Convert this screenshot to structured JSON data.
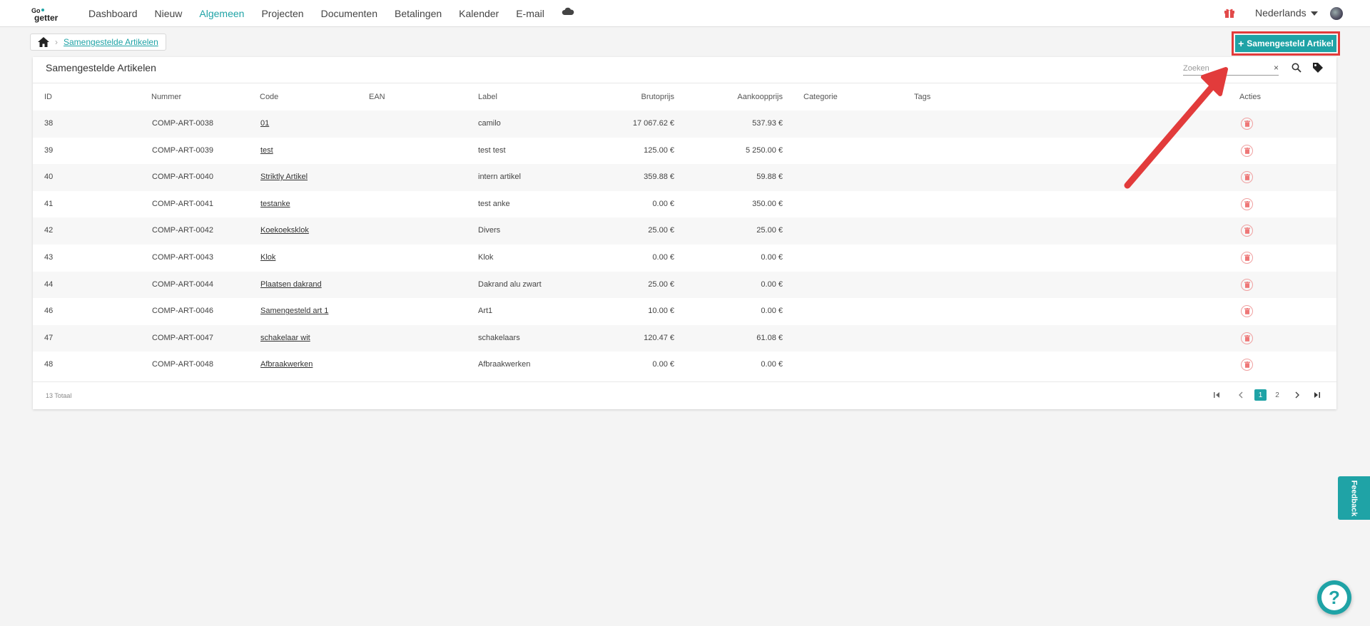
{
  "nav": {
    "logo_alt": "GoGetter",
    "items": [
      "Dashboard",
      "Nieuw",
      "Algemeen",
      "Projecten",
      "Documenten",
      "Betalingen",
      "Kalender",
      "E-mail"
    ],
    "active": "Algemeen",
    "language": "Nederlands"
  },
  "breadcrumb": {
    "current": "Samengestelde Artikelen"
  },
  "add_button_label": "Samengesteld Artikel",
  "card": {
    "title": "Samengestelde Artikelen",
    "search_placeholder": "Zoeken",
    "search_clear": "×"
  },
  "table": {
    "columns": [
      "ID",
      "Nummer",
      "Code",
      "EAN",
      "Label",
      "Brutoprijs",
      "Aankoopprijs",
      "Categorie",
      "Tags",
      "Acties"
    ],
    "rows": [
      {
        "id": "38",
        "nummer": "COMP-ART-0038",
        "code": "01",
        "ean": "",
        "label": "camilo",
        "brutoprijs": "17 067.62 €",
        "aankoopprijs": "537.93 €"
      },
      {
        "id": "39",
        "nummer": "COMP-ART-0039",
        "code": "test",
        "ean": "",
        "label": "test test",
        "brutoprijs": "125.00 €",
        "aankoopprijs": "5 250.00 €"
      },
      {
        "id": "40",
        "nummer": "COMP-ART-0040",
        "code": "Striktly Artikel",
        "ean": "",
        "label": "intern artikel",
        "brutoprijs": "359.88 €",
        "aankoopprijs": "59.88 €"
      },
      {
        "id": "41",
        "nummer": "COMP-ART-0041",
        "code": "testanke",
        "ean": "",
        "label": "test anke",
        "brutoprijs": "0.00 €",
        "aankoopprijs": "350.00 €"
      },
      {
        "id": "42",
        "nummer": "COMP-ART-0042",
        "code": "Koekoeksklok",
        "ean": "",
        "label": "Divers",
        "brutoprijs": "25.00 €",
        "aankoopprijs": "25.00 €"
      },
      {
        "id": "43",
        "nummer": "COMP-ART-0043",
        "code": "Klok",
        "ean": "",
        "label": "Klok",
        "brutoprijs": "0.00 €",
        "aankoopprijs": "0.00 €"
      },
      {
        "id": "44",
        "nummer": "COMP-ART-0044",
        "code": "Plaatsen dakrand",
        "ean": "",
        "label": "Dakrand alu zwart",
        "brutoprijs": "25.00 €",
        "aankoopprijs": "0.00 €"
      },
      {
        "id": "46",
        "nummer": "COMP-ART-0046",
        "code": "Samengesteld art 1",
        "ean": "",
        "label": "Art1",
        "brutoprijs": "10.00 €",
        "aankoopprijs": "0.00 €"
      },
      {
        "id": "47",
        "nummer": "COMP-ART-0047",
        "code": "schakelaar wit",
        "ean": "",
        "label": "schakelaars",
        "brutoprijs": "120.47 €",
        "aankoopprijs": "61.08 €"
      },
      {
        "id": "48",
        "nummer": "COMP-ART-0048",
        "code": "Afbraakwerken",
        "ean": "",
        "label": "Afbraakwerken",
        "brutoprijs": "0.00 €",
        "aankoopprijs": "0.00 €"
      }
    ]
  },
  "footer": {
    "total": "13 Totaal",
    "pages": [
      "1",
      "2"
    ],
    "current_page": "1"
  },
  "feedback_label": "Feedback",
  "help_label": "?",
  "colors": {
    "accent": "#1fa3a6",
    "highlight": "#e23b3b",
    "delete": "#e88"
  }
}
